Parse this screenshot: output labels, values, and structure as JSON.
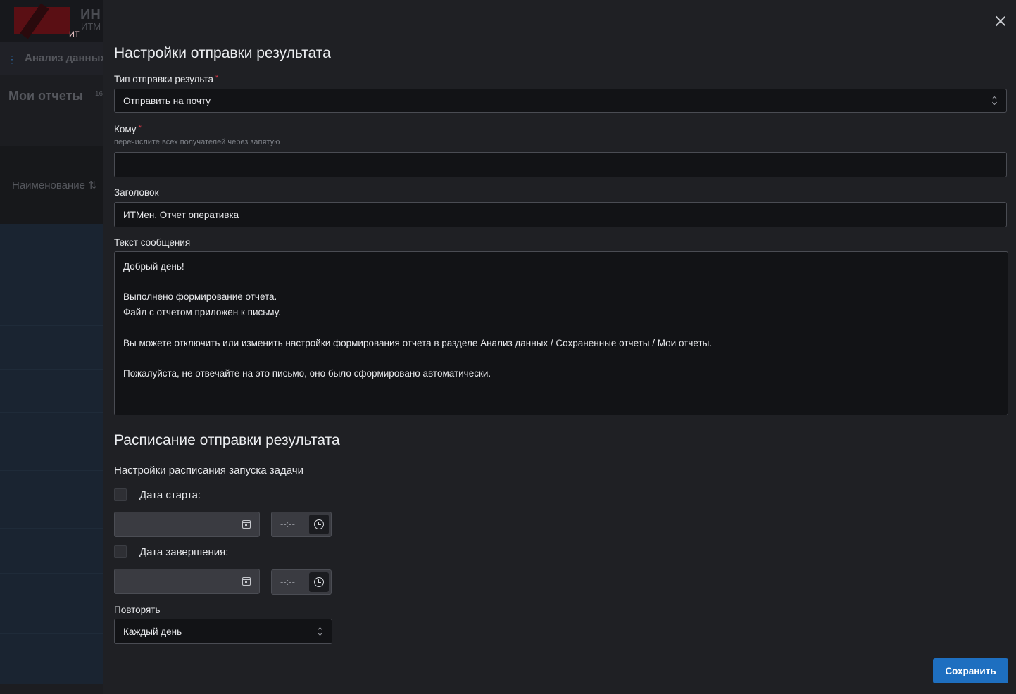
{
  "background": {
    "logo_badge": "ИТ",
    "logo_line1": "ИН",
    "logo_line2": "ИТМ",
    "nav_label": "Анализ данных",
    "page_title": "Мои отчеты",
    "count": "16",
    "column_header": "Наименование",
    "sort_icon": "⇅"
  },
  "dialog": {
    "title": "Настройки отправки результата",
    "send_type": {
      "label": "Тип отправки результа",
      "required_mark": "*",
      "value": "Отправить на почту"
    },
    "to": {
      "label": "Кому",
      "required_mark": "*",
      "hint": "перечислите всех получателей через запятую",
      "value": ""
    },
    "subject": {
      "label": "Заголовок",
      "value": "ИТМен. Отчет оперативка"
    },
    "message": {
      "label": "Текст сообщения",
      "value": "Добрый день!\n\nВыполнено формирование отчета.\nФайл с отчетом приложен к письму.\n\nВы можете отключить или изменить настройки формирования отчета в разделе Анализ данных / Сохраненные отчеты / Мои отчеты.\n\nПожалуйста, не отвечайте на это письмо, оно было сформировано автоматически."
    },
    "schedule_title": "Расписание отправки результата",
    "schedule_subtitle": "Настройки расписания запуска задачи",
    "start": {
      "label": "Дата старта:",
      "checked": false,
      "date": "",
      "time_placeholder": "--:--"
    },
    "end": {
      "label": "Дата завершения:",
      "checked": false,
      "date": "",
      "time_placeholder": "--:--"
    },
    "repeat": {
      "label": "Повторять",
      "value": "Каждый день"
    },
    "save_label": "Сохранить",
    "icons": [
      "close-icon",
      "chevron-updown-icon",
      "calendar-icon",
      "clock-icon"
    ],
    "colors": {
      "accent": "#1e6fc0",
      "required": "#e0394a",
      "background": "#1f2024"
    }
  }
}
